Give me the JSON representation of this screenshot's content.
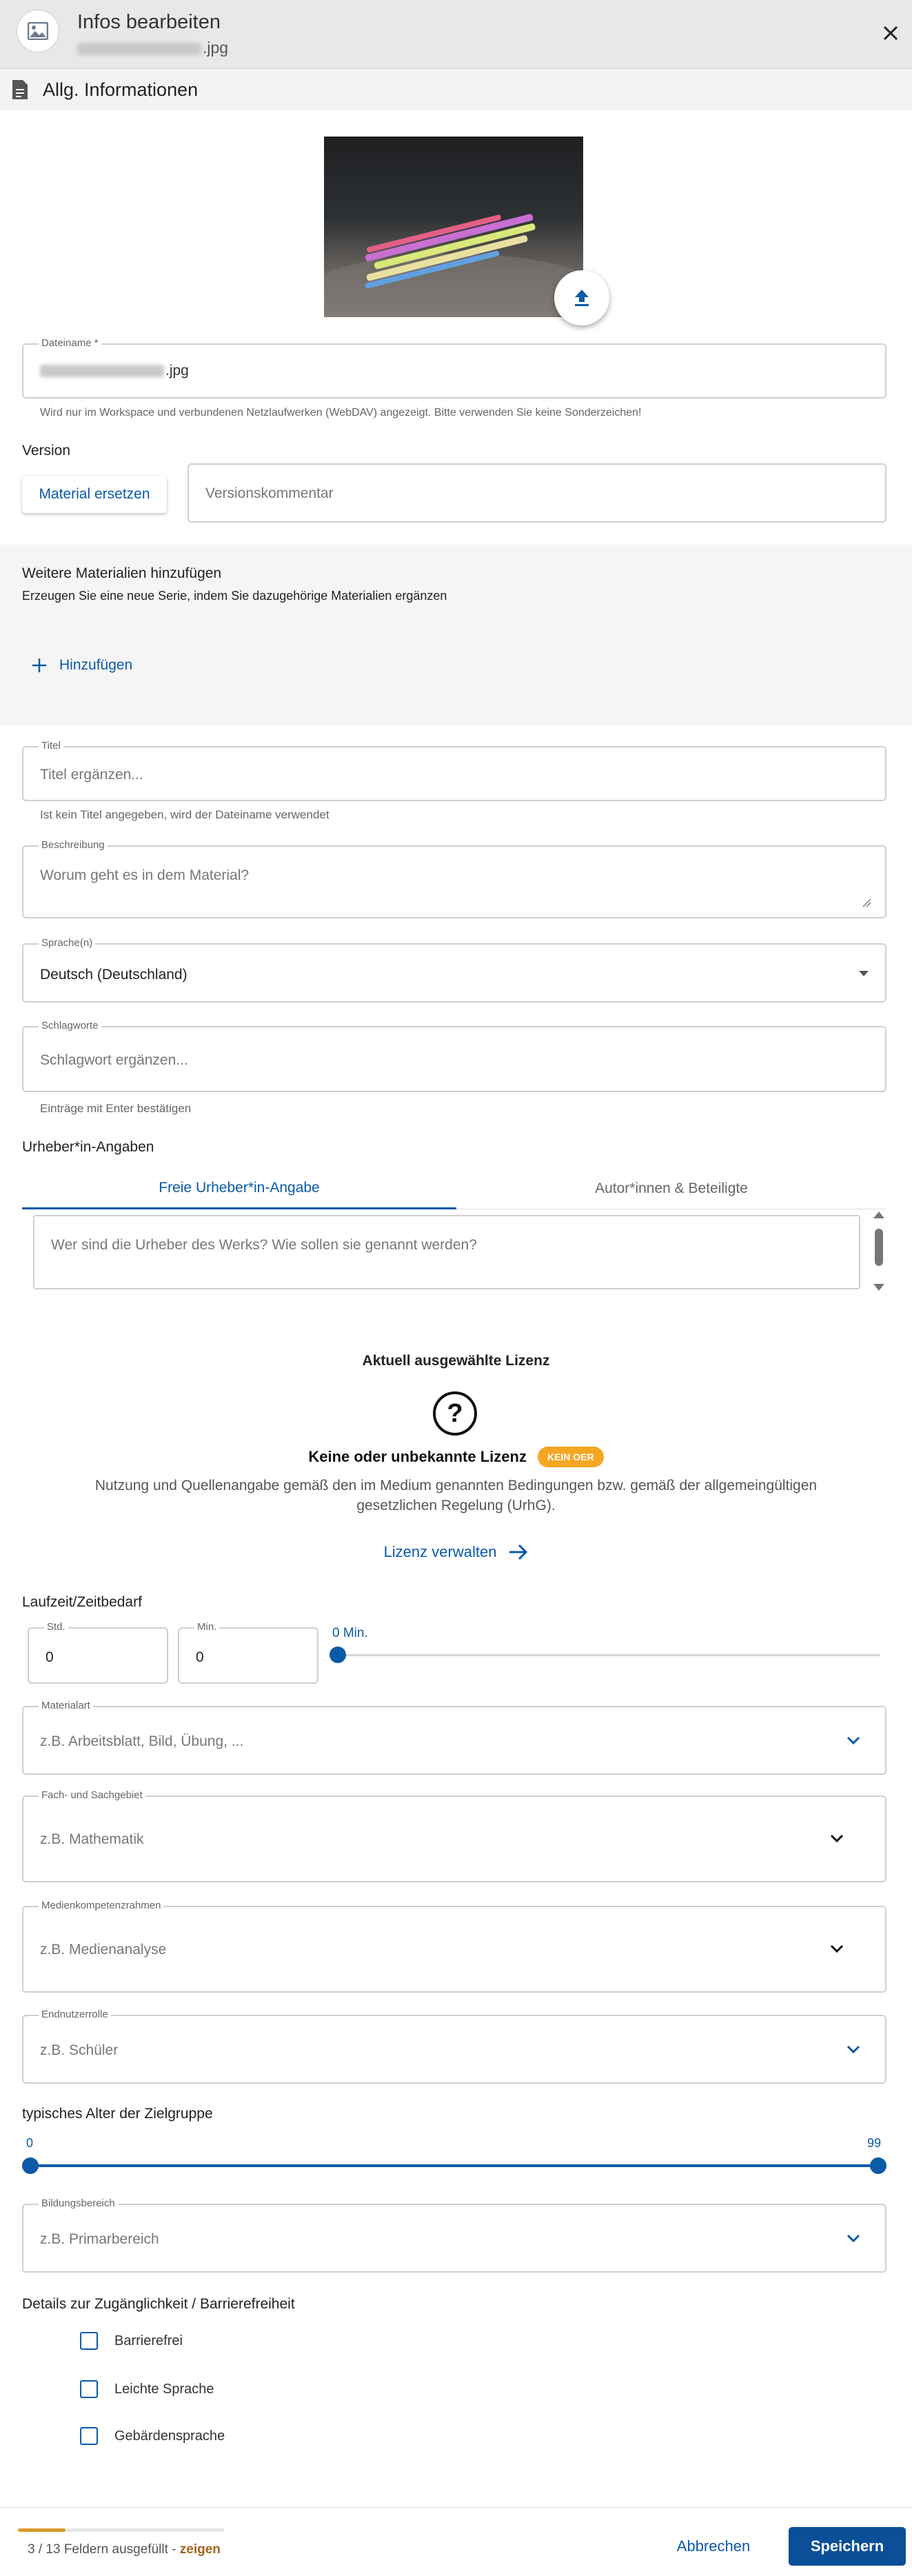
{
  "dialog": {
    "title": "Infos bearbeiten",
    "filename_ext": ".jpg",
    "section": "Allg. Informationen"
  },
  "filename": {
    "label": "Dateiname *",
    "value_ext": ".jpg",
    "hint": "Wird nur im Workspace und verbundenen Netzlaufwerken (WebDAV) angezeigt. Bitte verwenden Sie keine Sonderzeichen!"
  },
  "version": {
    "heading": "Version",
    "replace_button": "Material ersetzen",
    "comment_placeholder": "Versionskommentar"
  },
  "series": {
    "heading": "Weitere Materialien hinzufügen",
    "subtitle": "Erzeugen Sie eine neue Serie, indem Sie dazugehörige Materialien ergänzen",
    "add_button": "Hinzufügen"
  },
  "title_field": {
    "label": "Titel",
    "placeholder": "Titel ergänzen...",
    "hint": "Ist kein Titel angegeben, wird der Dateiname verwendet"
  },
  "description": {
    "label": "Beschreibung",
    "placeholder": "Worum geht es in dem Material?"
  },
  "language": {
    "label": "Sprache(n)",
    "value": "Deutsch (Deutschland)"
  },
  "keywords": {
    "label": "Schlagworte",
    "placeholder": "Schlagwort ergänzen...",
    "hint": "Einträge mit Enter bestätigen"
  },
  "author": {
    "heading": "Urheber*in-Angaben",
    "tabs": [
      "Freie Urheber*in-Angabe",
      "Autor*innen & Beteiligte"
    ],
    "placeholder": "Wer sind die Urheber des Werks? Wie sollen sie genannt werden?"
  },
  "license": {
    "heading": "Aktuell ausgewählte Lizenz",
    "name": "Keine oder unbekannte Lizenz",
    "badge": "KEIN OER",
    "description": "Nutzung und Quellenangabe gemäß den im Medium genannten Bedingungen bzw. gemäß der allgemeingültigen gesetzlichen Regelung (UrhG).",
    "manage_link": "Lizenz verwalten"
  },
  "duration": {
    "heading": "Laufzeit/Zeitbedarf",
    "hours_label": "Std.",
    "hours_value": "0",
    "minutes_label": "Min.",
    "minutes_value": "0",
    "slider_label": "0 Min."
  },
  "material_type": {
    "label": "Materialart",
    "placeholder": "z.B. Arbeitsblatt, Bild, Übung, ..."
  },
  "subject": {
    "label": "Fach- und Sachgebiet",
    "placeholder": "z.B. Mathematik"
  },
  "media_competence": {
    "label": "Medienkompetenzrahmen",
    "placeholder": "z.B. Medienanalyse"
  },
  "end_user_role": {
    "label": "Endnutzerrolle",
    "placeholder": "z.B. Schüler"
  },
  "age": {
    "heading": "typisches Alter der Zielgruppe",
    "min": "0",
    "max": "99"
  },
  "education_level": {
    "label": "Bildungsbereich",
    "placeholder": "z.B. Primarbereich"
  },
  "accessibility": {
    "heading": "Details zur Zugänglichkeit / Barrierefreiheit",
    "options": [
      "Barrierefrei",
      "Leichte Sprache",
      "Gebärdensprache"
    ]
  },
  "footer": {
    "progress_text": "3 / 13 Feldern ausgefüllt - ",
    "progress_link": "zeigen",
    "progress_fraction": 0.23,
    "cancel": "Abbrechen",
    "save": "Speichern"
  },
  "colors": {
    "accent": "#0b5aa6",
    "badge": "#f5a623",
    "progress": "#d79a2a"
  }
}
